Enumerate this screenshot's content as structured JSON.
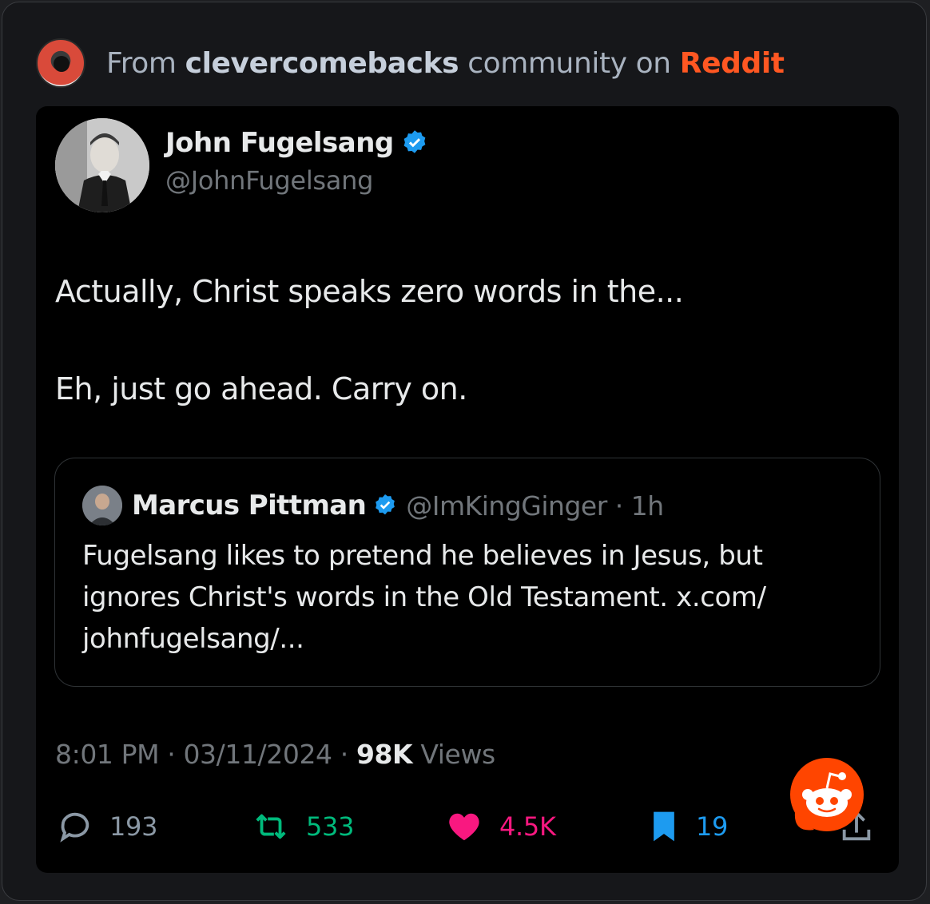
{
  "source": {
    "prefix": "From",
    "community": "clevercomebacks",
    "middle": "community on",
    "platform": "Reddit"
  },
  "tweet": {
    "author_name": "John Fugelsang",
    "author_handle": "@JohnFugelsang",
    "text_line1": "Actually, Christ speaks zero words in the...",
    "text_line2": "Eh, just go ahead.  Carry on.",
    "quote": {
      "name": "Marcus Pittman",
      "handle_time": "@ImKingGinger · 1h",
      "text": "Fugelsang likes to pretend he believes in Jesus, but ignores Christ's words in the Old Testament. x.com/ johnfugelsang/..."
    },
    "meta": {
      "time": "8:01 PM",
      "date": "03/11/2024",
      "views_count": "98K",
      "views_label": "Views"
    },
    "stats": {
      "replies": "193",
      "retweets": "533",
      "likes": "4.5K",
      "bookmarks": "19"
    }
  },
  "colors": {
    "reddit_orange": "#ff5722",
    "verified_blue": "#1d9bf0",
    "retweet_green": "#00ba7c",
    "like_pink": "#f91880"
  },
  "icons": [
    "subreddit-avatar",
    "verified-badge-icon",
    "reply-icon",
    "retweet-icon",
    "heart-icon",
    "bookmark-icon",
    "share-icon",
    "reddit-snoo-icon"
  ]
}
